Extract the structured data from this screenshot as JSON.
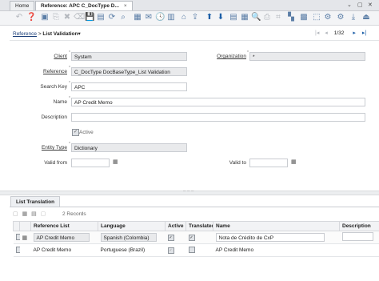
{
  "tabs": [
    {
      "label": "Home"
    },
    {
      "label": "Reference: APC C_DocType D...",
      "close": "×"
    }
  ],
  "window_icons": [
    "⌄",
    "▢",
    "✕"
  ],
  "breadcrumb": {
    "link": "Reference",
    "sep": ">",
    "current": "List Validation",
    "arrow": "▾"
  },
  "navigation": {
    "record_position": "1/32"
  },
  "form": {
    "client": {
      "label": "Client",
      "value": "System"
    },
    "organization": {
      "label": "Organization",
      "value": "*"
    },
    "reference": {
      "label": "Reference",
      "value": "C_DocType DocBaseType_List Validation"
    },
    "search_key": {
      "label": "Search Key",
      "value": "APC"
    },
    "name": {
      "label": "Name",
      "value": "AP Credit Memo"
    },
    "description": {
      "label": "Description",
      "value": ""
    },
    "active": {
      "label": "Active",
      "checked": true
    },
    "entity_type": {
      "label": "Entity Type",
      "value": "Dictionary"
    },
    "valid_from": {
      "label": "Valid from",
      "value": ""
    },
    "valid_to": {
      "label": "Valid to",
      "value": ""
    }
  },
  "bottom": {
    "tab_label": "List Translation",
    "records": "2 Records",
    "columns": [
      "Reference List",
      "Language",
      "Active",
      "Translated",
      "Name",
      "Description"
    ],
    "rows": [
      {
        "reference_list": "AP Credit Memo",
        "language": "Spanish (Colombia)",
        "active": true,
        "translated": true,
        "name": "Nota de Crédito de CxP",
        "description": ""
      },
      {
        "reference_list": "AP Credit Memo",
        "language": "Portuguese (Brazil)",
        "active": true,
        "translated": false,
        "name": "AP Credit Memo",
        "description": ""
      }
    ]
  },
  "colors": {
    "link": "#1a3e78",
    "nav_blue": "#1b5ea7",
    "readonly_bg": "#e9eaec"
  }
}
